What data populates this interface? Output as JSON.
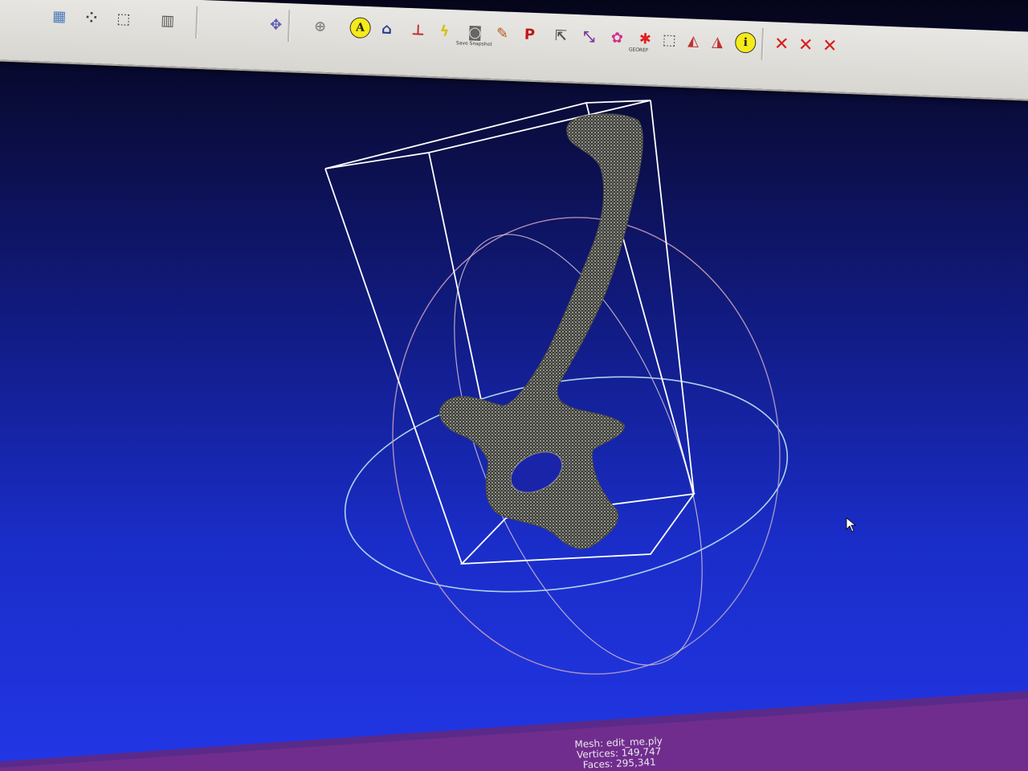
{
  "toolbar": {
    "buttons": [
      {
        "name": "layer-icon",
        "glyph": "▦"
      },
      {
        "name": "point-cloud-icon",
        "glyph": "⁘"
      },
      {
        "name": "wireframe-box-icon",
        "glyph": "⬚"
      },
      {
        "name": "cube-grid-icon",
        "glyph": "▥"
      },
      {
        "name": "align-axes-icon",
        "glyph": "✥"
      },
      {
        "name": "crosshair-icon",
        "glyph": "⊕"
      },
      {
        "name": "annotation-a-icon",
        "glyph": "A"
      },
      {
        "name": "home-icon",
        "glyph": "⌂"
      },
      {
        "name": "axis-icon",
        "glyph": "⊥"
      },
      {
        "name": "lightning-icon",
        "glyph": "ϟ"
      },
      {
        "name": "camera-icon",
        "glyph": "◙"
      },
      {
        "name": "paintbrush-icon",
        "glyph": "✎"
      },
      {
        "name": "pp-icon",
        "glyph": "P"
      },
      {
        "name": "select-vertex-icon",
        "glyph": "⇱"
      },
      {
        "name": "measure-icon",
        "glyph": "⤡"
      },
      {
        "name": "rainbow-paint-icon",
        "glyph": "✿"
      },
      {
        "name": "georef-icon",
        "glyph": "✱"
      },
      {
        "name": "select-faces-icon",
        "glyph": "⬚"
      },
      {
        "name": "select-connected-icon",
        "glyph": "◭"
      },
      {
        "name": "select-region-icon",
        "glyph": "◮"
      },
      {
        "name": "info-icon",
        "glyph": "i"
      },
      {
        "name": "delete-vertices-icon",
        "glyph": "✕"
      },
      {
        "name": "delete-faces-icon",
        "glyph": "✕"
      },
      {
        "name": "delete-selection-icon",
        "glyph": "✕"
      }
    ],
    "georef_label": "GEOREF",
    "camera_label": "Save Snapshot"
  },
  "status": {
    "mesh": "Mesh: edit_me.ply",
    "vertices": "Vertices: 149,747",
    "faces": "Faces: 295,341"
  },
  "colors": {
    "viewport_top": "#05051a",
    "viewport_bottom": "#2236e6",
    "bbox": "#ffffff",
    "mesh": "#7a7a72"
  }
}
